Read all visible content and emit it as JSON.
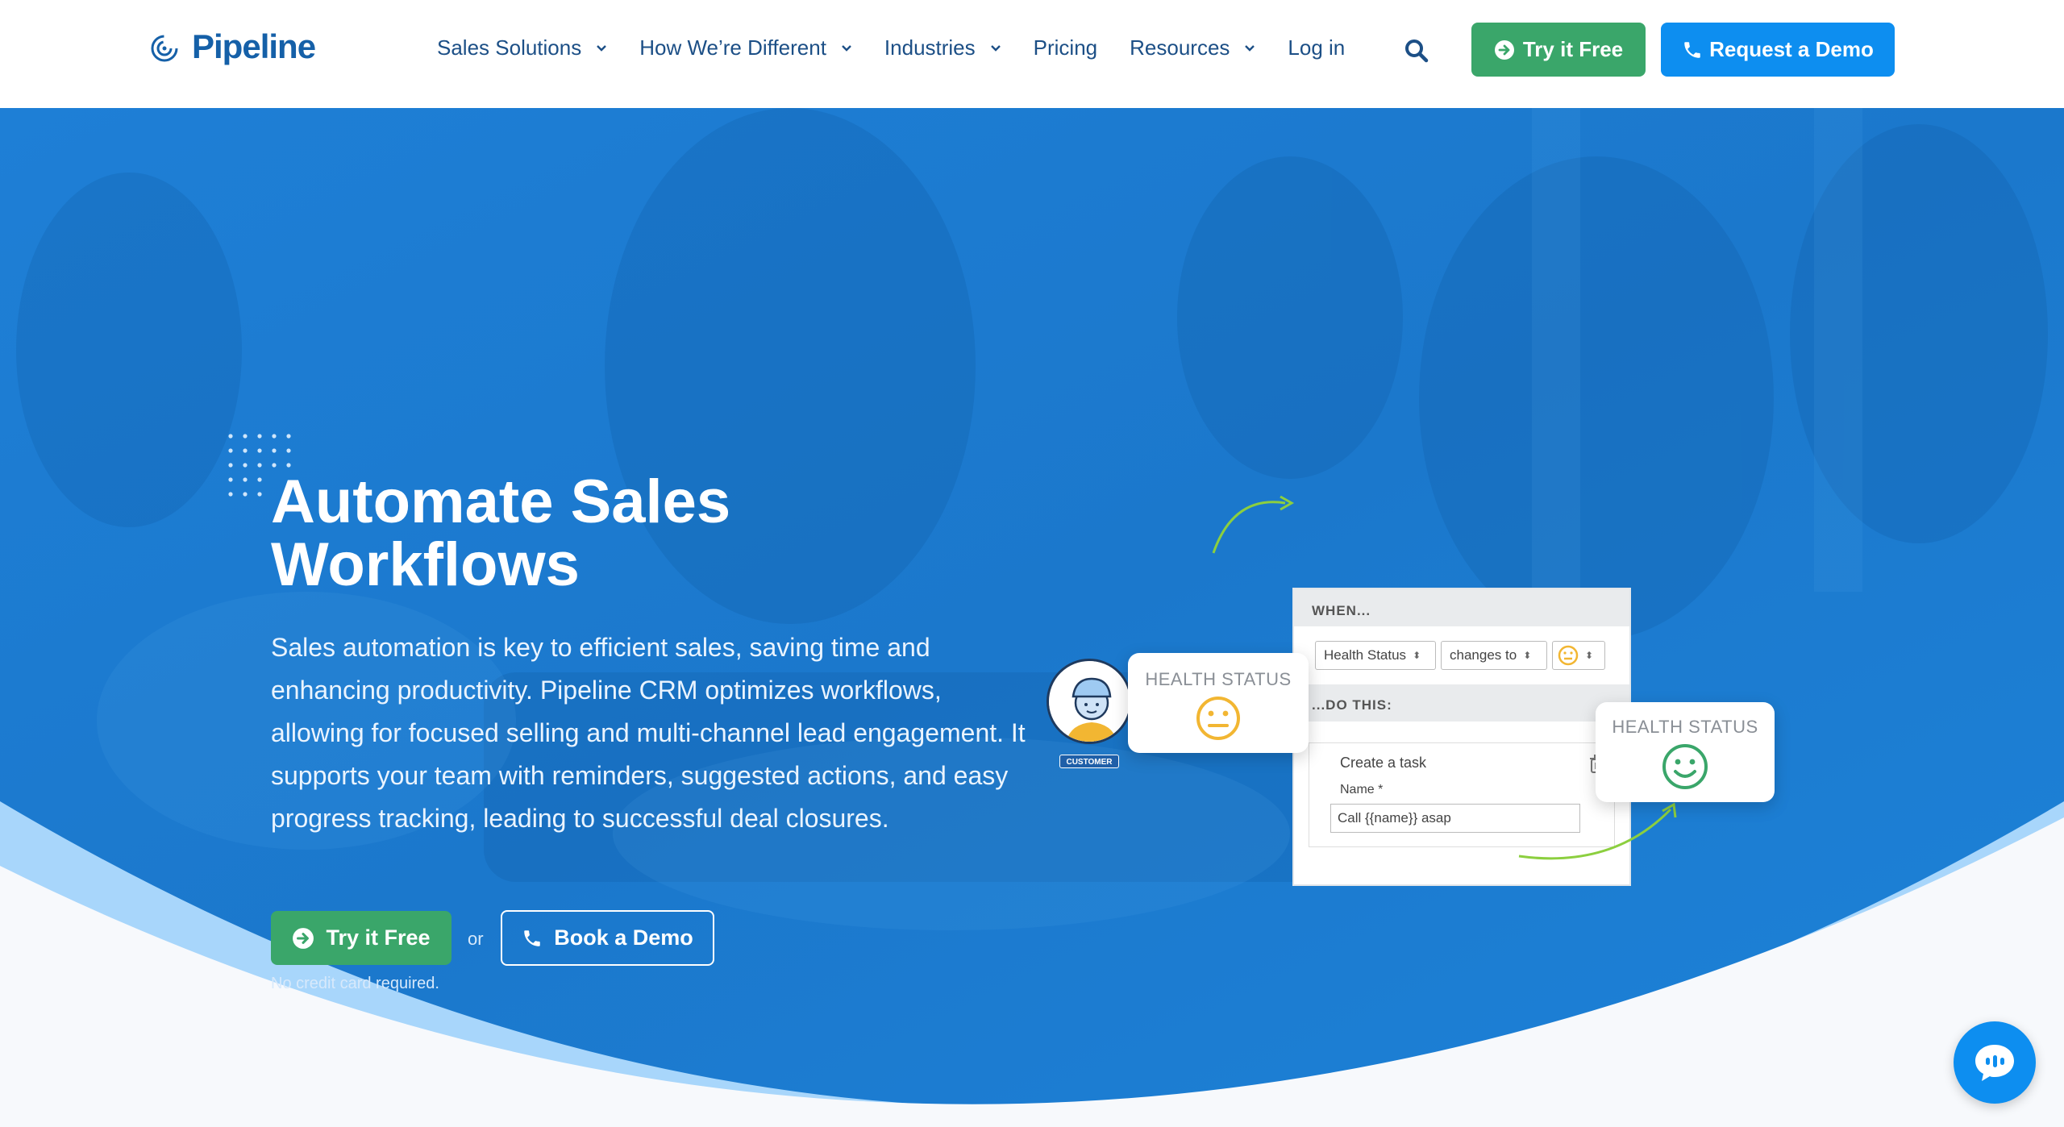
{
  "brand": {
    "name": "Pipeline"
  },
  "nav": {
    "items": [
      {
        "label": "Sales Solutions",
        "dropdown": true
      },
      {
        "label": "How We’re Different",
        "dropdown": true
      },
      {
        "label": "Industries",
        "dropdown": true
      },
      {
        "label": "Pricing",
        "dropdown": false
      },
      {
        "label": "Resources",
        "dropdown": true
      },
      {
        "label": "Log in",
        "dropdown": false
      }
    ],
    "try_label": "Try it Free",
    "demo_label": "Request a Demo"
  },
  "hero": {
    "title": "Automate Sales Workflows",
    "description": "Sales automation is key to efficient sales, saving time and enhancing productivity. Pipeline CRM optimizes workflows, allowing for focused selling and multi-channel lead engagement. It supports your team with reminders, suggested actions, and easy progress tracking, leading to successful deal closures.",
    "try_label": "Try it Free",
    "or_label": "or",
    "book_label": "Book a Demo",
    "note": "No credit card required."
  },
  "workflow": {
    "when_label": "WHEN...",
    "field_select": "Health Status",
    "operator_select": "changes to",
    "do_label": "...DO THIS:",
    "task_title": "Create a task",
    "name_label": "Name *",
    "name_value": "Call {{name}} asap",
    "health_label_1": "HEALTH STATUS",
    "health_label_2": "HEALTH STATUS",
    "customer_tag": "CUSTOMER"
  },
  "colors": {
    "brand_blue": "#1560a8",
    "cta_green": "#3aa66a",
    "cta_blue": "#0d8ef0",
    "hero_blue": "#1b7fd4",
    "neutral_face": "#f2b632",
    "happy_face": "#3aa66a"
  },
  "icons": {
    "search": "search-icon",
    "arrow_circle": "arrow-right-circle-icon",
    "phone": "phone-icon",
    "chat": "chat-icon",
    "trash": "trash-icon"
  }
}
